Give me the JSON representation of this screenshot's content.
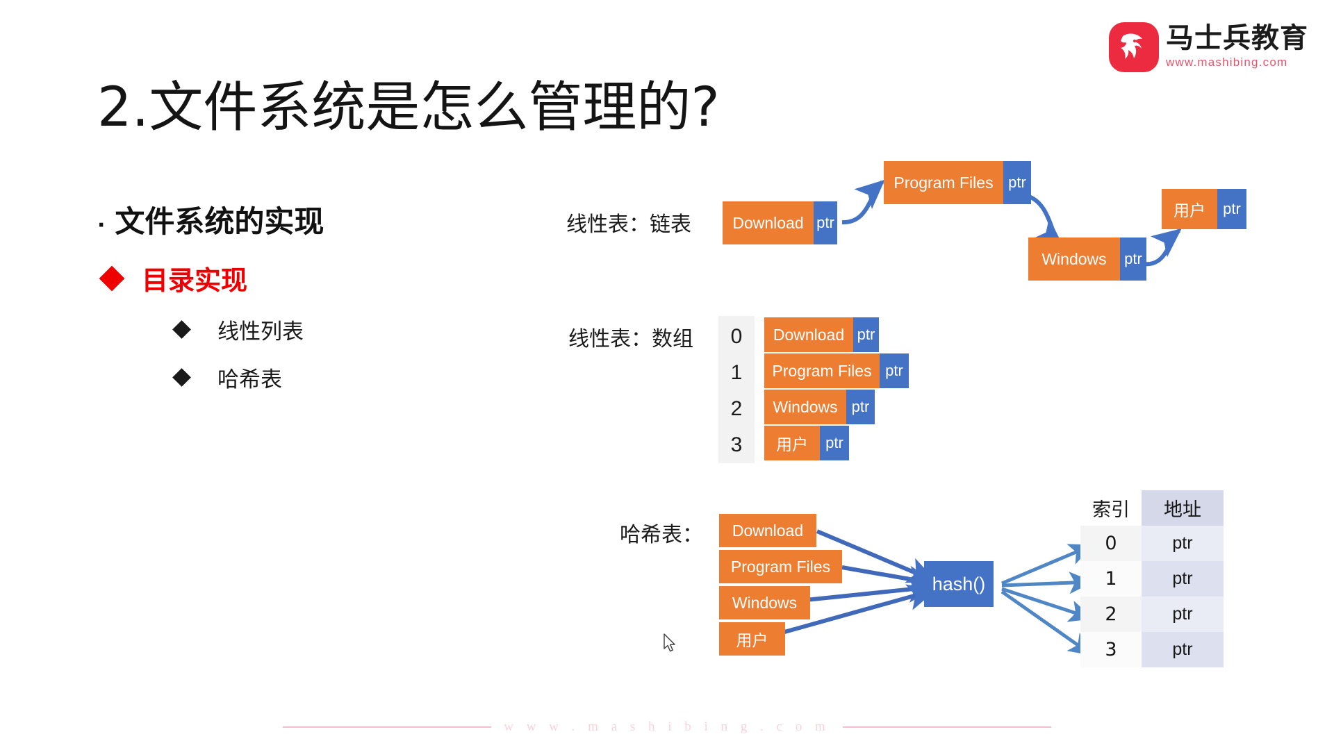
{
  "brand": {
    "name_cn": "马士兵教育",
    "url": "www.mashibing.com",
    "mark_color": "#ec2b40",
    "url_color": "#e8536a"
  },
  "title": "2.文件系统是怎么管理的?",
  "outline": {
    "level1": {
      "bullet": "·",
      "text": "文件系统的实现"
    },
    "level2": {
      "bullet": "◆",
      "text": "目录实现",
      "color": "#ee0000"
    },
    "level3": [
      {
        "bullet": "◆",
        "text": "线性列表"
      },
      {
        "bullet": "◆",
        "text": "哈希表"
      }
    ]
  },
  "colors": {
    "orange": "#ed7d31",
    "blue": "#4472c4",
    "arrow": "#4472c4",
    "table_index_bg": "#f2f2f2",
    "table_addr_bg": "#e9ebf5",
    "table_addr_header_bg": "#d4d8e8"
  },
  "linked_list": {
    "label": "线性表：链表",
    "ptr_label": "ptr",
    "nodes": [
      {
        "name": "Download",
        "ptr": "ptr"
      },
      {
        "name": "Program Files",
        "ptr": "ptr"
      },
      {
        "name": "Windows",
        "ptr": "ptr"
      },
      {
        "name": "用户",
        "ptr": "ptr"
      }
    ]
  },
  "array": {
    "label": "线性表：数组",
    "rows": [
      {
        "index": "0",
        "name": "Download",
        "ptr": "ptr"
      },
      {
        "index": "1",
        "name": "Program Files",
        "ptr": "ptr"
      },
      {
        "index": "2",
        "name": "Windows",
        "ptr": "ptr"
      },
      {
        "index": "3",
        "name": "用户",
        "ptr": "ptr"
      }
    ]
  },
  "hash": {
    "label": "哈希表：",
    "inputs": [
      "Download",
      "Program Files",
      "Windows",
      "用户"
    ],
    "function_label": "hash()",
    "table": {
      "headers": [
        "索引",
        "地址"
      ],
      "rows": [
        {
          "index": "0",
          "address": "ptr"
        },
        {
          "index": "1",
          "address": "ptr"
        },
        {
          "index": "2",
          "address": "ptr"
        },
        {
          "index": "3",
          "address": "ptr"
        }
      ]
    }
  },
  "footer": {
    "text": "w w w . m a s h i b i n g . c o m"
  }
}
